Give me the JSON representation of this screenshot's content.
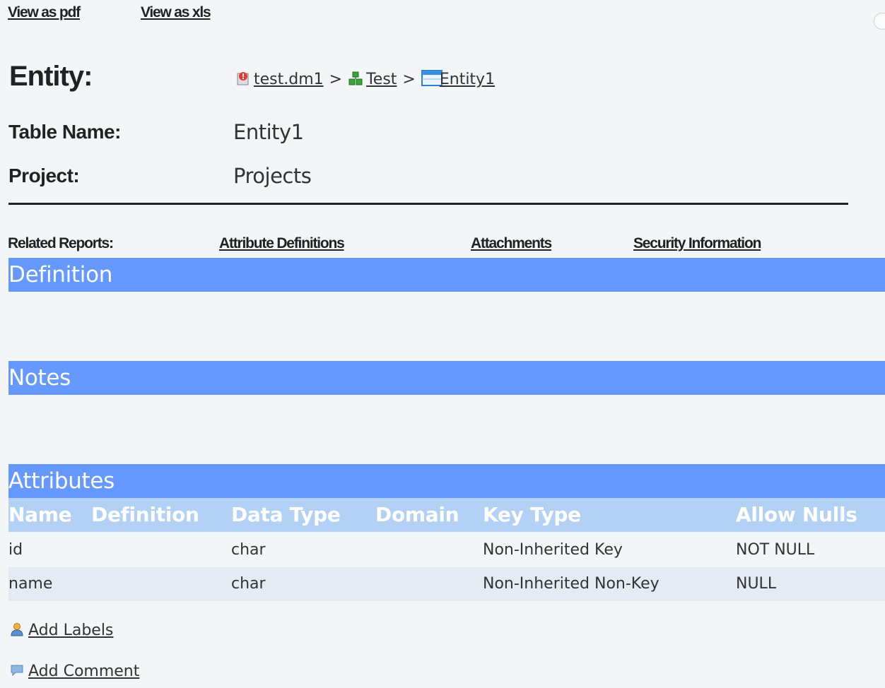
{
  "toolbar": {
    "view_pdf": "View as pdf",
    "view_xls": "View as xls"
  },
  "header": {
    "title": "Entity:",
    "breadcrumb": [
      {
        "label": "test.dm1",
        "icon": "model-file-icon"
      },
      {
        "label": "Test",
        "icon": "green-subject-area-icon"
      },
      {
        "label": "Entity1",
        "icon": "entity-table-icon"
      }
    ],
    "separator": ">"
  },
  "fields": {
    "table_name_label": "Table Name:",
    "table_name_value": "Entity1",
    "project_label": "Project:",
    "project_value": "Projects"
  },
  "related": {
    "label": "Related Reports:",
    "links": [
      "Attribute Definitions",
      "Attachments",
      "Security Information"
    ]
  },
  "sections": {
    "definition": "Definition",
    "notes": "Notes",
    "attributes": "Attributes"
  },
  "table": {
    "columns": [
      "Name",
      "Definition",
      "Data Type",
      "Domain",
      "Key Type",
      "Allow Nulls"
    ],
    "rows": [
      [
        "id",
        "",
        "char",
        "",
        "Non-Inherited Key",
        "NOT NULL"
      ],
      [
        "name",
        "",
        "char",
        "",
        "Non-Inherited Non-Key",
        "NULL"
      ]
    ]
  },
  "actions": {
    "add_labels": "Add Labels",
    "add_comment": "Add Comment"
  },
  "colors": {
    "section_bar": "#6699ff",
    "table_header": "#b3d1f5",
    "row_alt": "#e4ebf2",
    "background": "#f4f5f6"
  }
}
